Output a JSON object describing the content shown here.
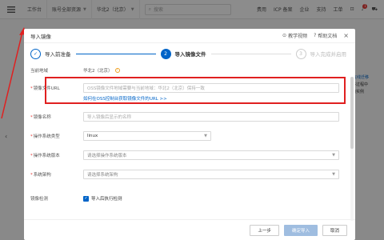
{
  "topbar": {
    "workbench": "工作台",
    "resource_group": "账号全部资源",
    "region": "华北2（北京）",
    "search_placeholder": "搜索",
    "links": [
      "费用",
      "ICP 备案",
      "企业",
      "支持",
      "工单"
    ],
    "notification_count": "1"
  },
  "background": {
    "right_lines": [
      "镜像",
      "SMC在线迁移",
      "在迁移过程中",
      "地启动实例"
    ],
    "right_link": "SMC在线迁移"
  },
  "dialog": {
    "title": "导入镜像",
    "actions": {
      "tutorial": "教学视频",
      "help": "帮助文档"
    },
    "steps": [
      {
        "num": "1",
        "label": "导入前准备",
        "state": "done"
      },
      {
        "num": "2",
        "label": "导入镜像文件",
        "state": "active"
      },
      {
        "num": "3",
        "label": "导入完成并启用",
        "state": "todo"
      }
    ],
    "form": {
      "region_label": "当前地域",
      "region_value": "华北2（北京）",
      "oss_label": "镜像文件URL",
      "oss_placeholder": "OSS镜像文件地域需要与当前地域：华北2（北京）保持一致",
      "oss_link": "如何在OSS控制台获取镜像文件的URL >>",
      "name_label": "镜像名称",
      "name_placeholder": "导入镜像后显示的名称",
      "os_type_label": "操作系统类型",
      "os_type_value": "linux",
      "os_version_label": "操作系统版本",
      "os_version_placeholder": "请选择操作系统版本",
      "arch_label": "系统架构",
      "arch_placeholder": "请选择系统架构",
      "check_label": "镜像检测",
      "check_text": "导入后执行检测"
    },
    "footer": {
      "prev": "上一步",
      "confirm": "确定导入",
      "cancel": "取消"
    }
  },
  "colors": {
    "accent": "#0064c8",
    "highlight": "#e02020",
    "warning": "#f0a020"
  }
}
